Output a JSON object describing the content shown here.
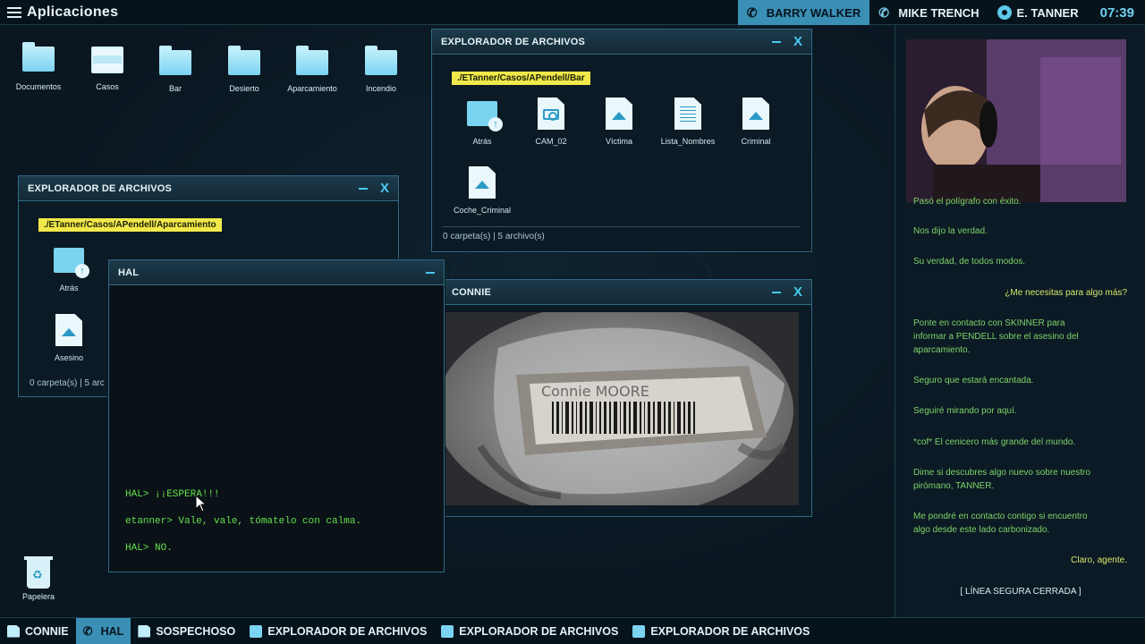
{
  "topbar": {
    "apps_label": "Aplicaciones",
    "contacts": [
      {
        "name": "BARRY WALKER",
        "icon": "phone-icon",
        "active": true
      },
      {
        "name": "MIKE TRENCH",
        "icon": "phone-icon",
        "active": false
      },
      {
        "name": "E. TANNER",
        "icon": "agent-badge-icon",
        "active": false
      }
    ],
    "clock": "07:39"
  },
  "desktop": {
    "icons": [
      {
        "label": "Documentos",
        "icon": "folder-icon"
      },
      {
        "label": "Casos",
        "icon": "cabinet-icon"
      },
      {
        "label": "Bar",
        "icon": "folder-icon"
      },
      {
        "label": "Desierto",
        "icon": "folder-icon"
      },
      {
        "label": "Aparcamiento",
        "icon": "folder-icon"
      },
      {
        "label": "Incendio",
        "icon": "folder-icon"
      }
    ],
    "trash_label": "Papelera"
  },
  "explorer_bar": {
    "title": "EXPLORADOR DE ARCHIVOS",
    "path": "./ETanner/Casos/APendell/Bar",
    "files": [
      {
        "label": "Atrás",
        "icon": "back-folder-icon"
      },
      {
        "label": "CAM_02",
        "icon": "photo-file-icon"
      },
      {
        "label": "Víctima",
        "icon": "image-file-icon"
      },
      {
        "label": "Lista_Nombres",
        "icon": "text-file-icon"
      },
      {
        "label": "Criminal",
        "icon": "image-file-icon"
      },
      {
        "label": "Coche_Criminal",
        "icon": "image-file-icon"
      }
    ],
    "status": "0 carpeta(s) | 5 archivo(s)"
  },
  "explorer_aparcamiento": {
    "title": "EXPLORADOR DE ARCHIVOS",
    "path": "./ETanner/Casos/APendell/Aparcamiento",
    "files": [
      {
        "label": "Atrás",
        "icon": "back-folder-icon"
      },
      {
        "label": "Asesino",
        "icon": "image-file-icon"
      }
    ],
    "status": "0 carpeta(s) | 5 arc"
  },
  "hal": {
    "title": "HAL",
    "lines": [
      "HAL> ¡¡ESPERA!!!",
      "etanner> Vale, vale, tómatelo con calma.",
      "HAL> NO."
    ]
  },
  "connie": {
    "title": "CONNIE",
    "image_text": "Connie MOORE"
  },
  "chat": {
    "messages": [
      {
        "side": "left",
        "text": "Pasó el polígrafo con éxito."
      },
      {
        "side": "left",
        "text": "Nos dijo la verdad."
      },
      {
        "side": "left",
        "text": "Su verdad, de todos modos."
      },
      {
        "side": "right",
        "text": "¿Me necesitas para algo más?"
      },
      {
        "side": "left",
        "text": "Ponte en contacto con SKINNER para informar a PENDELL sobre el asesino del aparcamiento."
      },
      {
        "side": "left",
        "text": "Seguro que estará encantada."
      },
      {
        "side": "left",
        "text": "Seguiré mirando por aquí."
      },
      {
        "side": "left",
        "text": "*cof* El cenicero más grande del mundo."
      },
      {
        "side": "left",
        "text": "Dime si descubres algo nuevo sobre nuestro pirómano, TANNER."
      },
      {
        "side": "left",
        "text": "Me pondré en contacto contigo si encuentro algo desde este lado carbonizado."
      },
      {
        "side": "right",
        "text": "Claro, agente."
      }
    ],
    "closed_label": "[  LÍNEA SEGURA CERRADA  ]"
  },
  "taskbar": {
    "items": [
      {
        "label": "CONNIE",
        "icon": "document-icon",
        "active": false
      },
      {
        "label": "HAL",
        "icon": "phone-icon",
        "active": true
      },
      {
        "label": "SOSPECHOSO",
        "icon": "document-icon",
        "active": false
      },
      {
        "label": "EXPLORADOR DE ARCHIVOS",
        "icon": "folder-icon",
        "active": false
      },
      {
        "label": "EXPLORADOR DE ARCHIVOS",
        "icon": "folder-icon",
        "active": false
      },
      {
        "label": "EXPLORADOR DE ARCHIVOS",
        "icon": "folder-icon",
        "active": false
      }
    ]
  }
}
